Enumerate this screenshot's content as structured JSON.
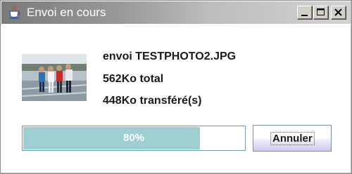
{
  "window": {
    "title": "Envoi en cours",
    "controls": [
      "minimize",
      "maximize",
      "close"
    ]
  },
  "transfer": {
    "filename_line": "envoi TESTPHOTO2.JPG",
    "total_line": "562Ko total",
    "transferred_line": "448Ko transféré(s)",
    "progress_percent": 80,
    "progress_label": "80%"
  },
  "actions": {
    "cancel_label": "Annuler"
  },
  "icons": {
    "app": "java-coffee-cup-icon",
    "thumbnail": "photo-thumbnail"
  },
  "colors": {
    "progress_fill": "#9dcfd3",
    "progress_border": "#6f9fa5"
  }
}
